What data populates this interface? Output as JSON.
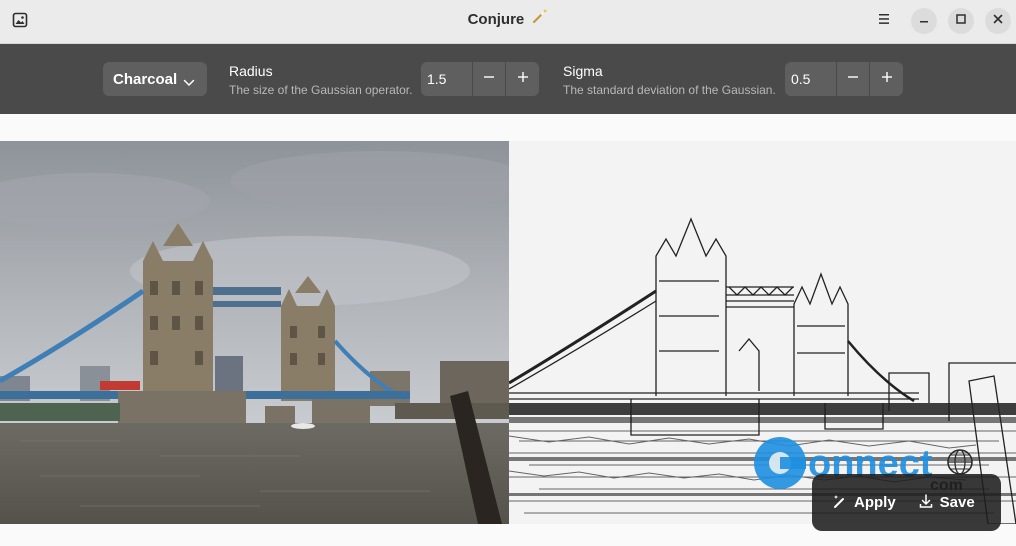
{
  "window": {
    "title": "Conjure",
    "title_icon": "magic-wand-icon"
  },
  "header": {
    "app_icon": "image-icon",
    "menu_icon": "hamburger-menu-icon",
    "minimize_icon": "minimize-icon",
    "maximize_icon": "maximize-icon",
    "close_icon": "close-icon"
  },
  "toolbar": {
    "filter": {
      "selected": "Charcoal",
      "icon": "chevron-down-icon"
    },
    "radius": {
      "label": "Radius",
      "description": "The size of the Gaussian operator.",
      "value": "1.5"
    },
    "sigma": {
      "label": "Sigma",
      "description": "The standard deviation of the Gaussian.",
      "value": "0.5"
    }
  },
  "content": {
    "original_image": "Tower Bridge photo",
    "processed_image": "Tower Bridge charcoal sketch"
  },
  "actions": {
    "apply_label": "Apply",
    "apply_icon": "magic-wand-icon",
    "save_label": "Save",
    "save_icon": "download-icon"
  },
  "watermark": {
    "text_main": "onnect",
    "text_sub": "com"
  },
  "colors": {
    "headerbar": "#ebebeb",
    "toolbar": "#4a4a4a",
    "control": "#5f5f5f",
    "watermark_blue": "#1e8fe0"
  }
}
